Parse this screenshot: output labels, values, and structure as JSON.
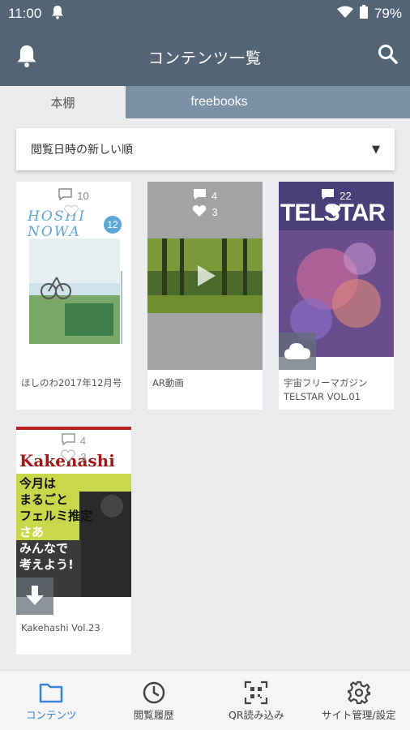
{
  "status_bar": {
    "time": "11:00",
    "battery": "79%"
  },
  "app_bar": {
    "title": "コンテンツ一覧"
  },
  "tabs": [
    {
      "label": "本棚",
      "active": true
    },
    {
      "label": "freebooks",
      "active": false
    }
  ],
  "sort": {
    "selected": "閲覧日時の新しい順"
  },
  "cards": [
    {
      "label": "ほしのわ2017年12月号",
      "comments": "10",
      "likes": "",
      "cover_title": "HOSHI NOWA",
      "cover_issue": "12",
      "badge": "none"
    },
    {
      "label": "AR動画",
      "comments": "4",
      "likes": "3",
      "badge": "none"
    },
    {
      "label": "宇宙フリーマガジン TELSTAR VOL.01",
      "comments": "22",
      "likes": "",
      "cover_title": "TELSTAR",
      "badge": "cloud-icon"
    },
    {
      "label": "Kakehashi Vol.23",
      "comments": "4",
      "likes": "3",
      "cover_title": "Kakehashi",
      "cover_text": [
        "今月は",
        "まるごと",
        "フェルミ推定",
        "さあ",
        "みんなで",
        "考えよう!"
      ],
      "badge": "download-icon"
    }
  ],
  "bottom_nav": [
    {
      "label": "コンテンツ",
      "icon": "folder-icon",
      "active": true
    },
    {
      "label": "閲覧履歴",
      "icon": "clock-icon",
      "active": false
    },
    {
      "label": "QR読み込み",
      "icon": "qr-icon",
      "active": false
    },
    {
      "label": "サイト管理/設定",
      "icon": "gear-icon",
      "active": false
    }
  ],
  "colors": {
    "header": "#536575",
    "tab_inactive": "#7b92a6",
    "accent": "#3b82d6",
    "background": "#ececef"
  }
}
